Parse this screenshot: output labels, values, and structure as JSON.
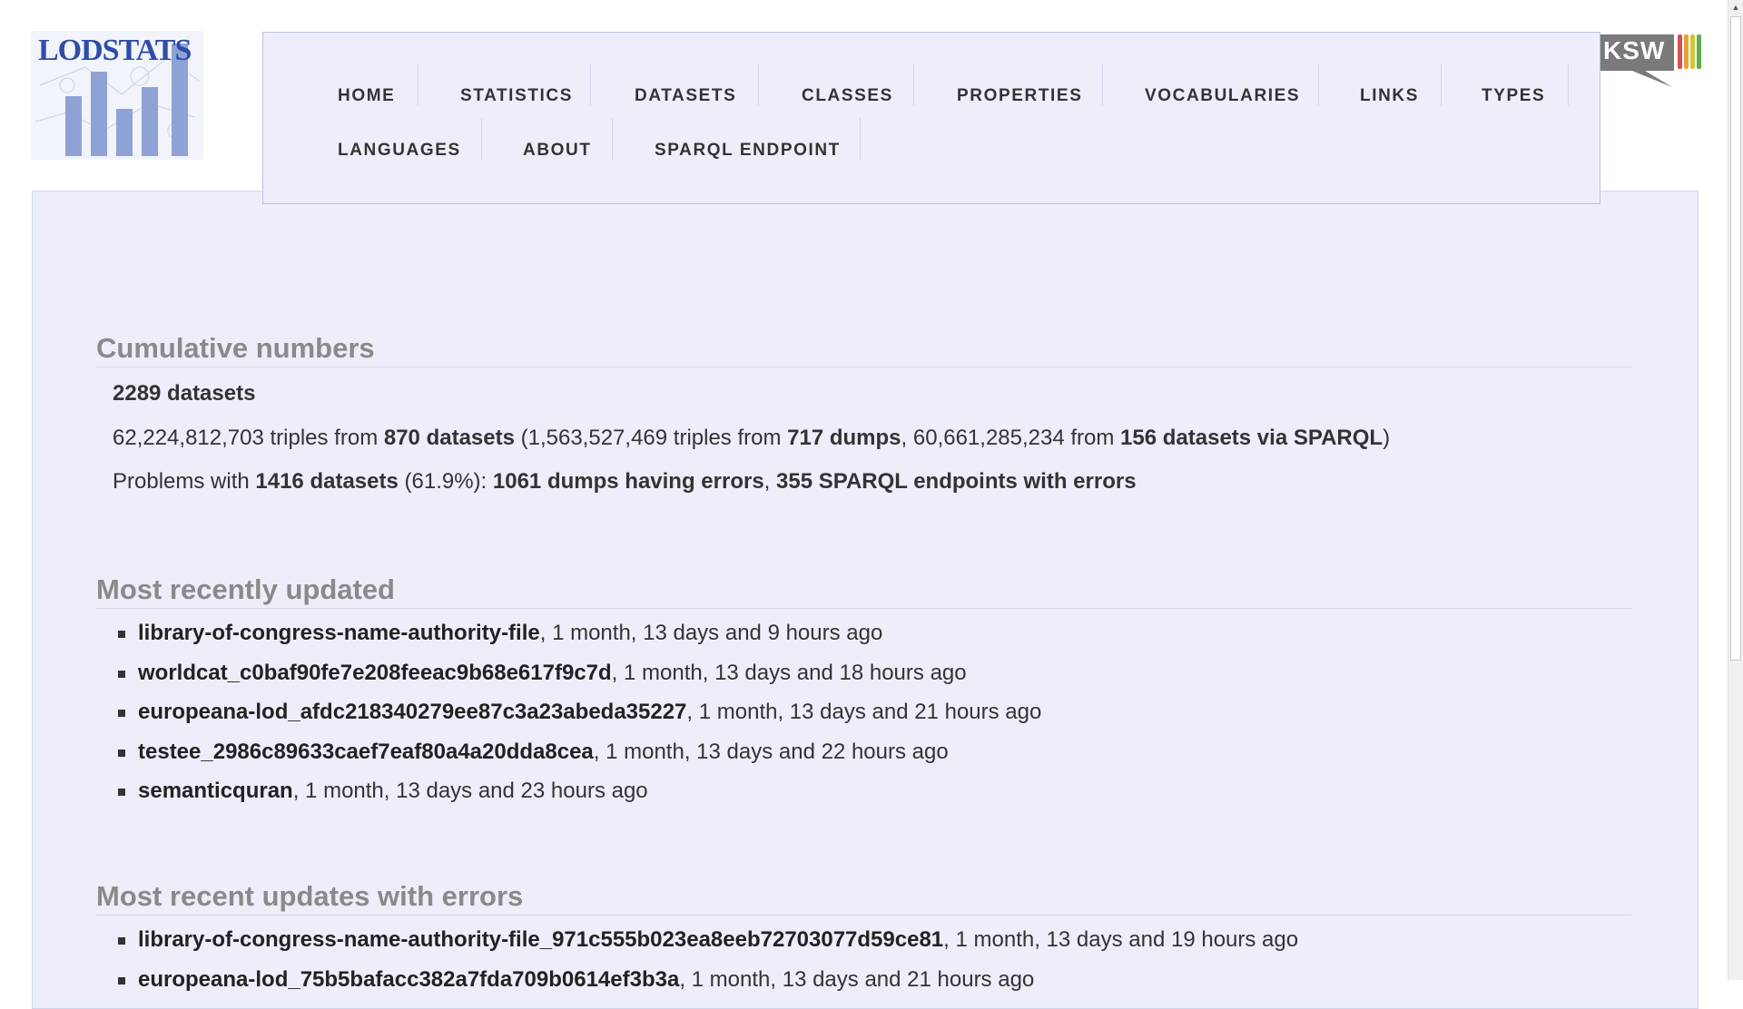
{
  "logo": {
    "text": "LODSTATS",
    "aksw_text": "KSW"
  },
  "nav": {
    "items": [
      "HOME",
      "STATISTICS",
      "DATASETS",
      "CLASSES",
      "PROPERTIES",
      "VOCABULARIES",
      "LINKS",
      "TYPES",
      "LANGUAGES",
      "ABOUT",
      "SPARQL ENDPOINT"
    ]
  },
  "cumulative": {
    "heading": "Cumulative numbers",
    "datasets_total": "2289 datasets",
    "triples_total": "62,224,812,703",
    "triples_from": " triples from ",
    "datasets_count": "870 datasets",
    "paren_open": " (",
    "dump_triples": "1,563,527,469",
    "dump_from": " triples from ",
    "dumps": "717 dumps",
    "comma": ", ",
    "sparql_triples": "60,661,285,234",
    "sparql_from": " from ",
    "sparql_datasets": "156 datasets via SPARQL",
    "paren_close": ")",
    "problems_prefix": "Problems with ",
    "problems_datasets": "1416 datasets",
    "problems_pct": " (61.9%): ",
    "dumps_errors": "1061 dumps having errors",
    "sep": ", ",
    "sparql_errors": "355 SPARQL endpoints with errors"
  },
  "recent": {
    "heading": "Most recently updated",
    "items": [
      {
        "name": "library-of-congress-name-authority-file",
        "time": ", 1 month, 13 days and 9 hours ago"
      },
      {
        "name": "worldcat_c0baf90fe7e208feeac9b68e617f9c7d",
        "time": ", 1 month, 13 days and 18 hours ago"
      },
      {
        "name": "europeana-lod_afdc218340279ee87c3a23abeda35227",
        "time": ", 1 month, 13 days and 21 hours ago"
      },
      {
        "name": "testee_2986c89633caef7eaf80a4a20dda8cea",
        "time": ", 1 month, 13 days and 22 hours ago"
      },
      {
        "name": "semanticquran",
        "time": ", 1 month, 13 days and 23 hours ago"
      }
    ]
  },
  "errors": {
    "heading": "Most recent updates with errors",
    "items": [
      {
        "name": "library-of-congress-name-authority-file_971c555b023ea8eeb72703077d59ce81",
        "time": ", 1 month, 13 days and 19 hours ago"
      },
      {
        "name": "europeana-lod_75b5bafacc382a7fda709b0614ef3b3a",
        "time": ", 1 month, 13 days and 21 hours ago"
      }
    ]
  }
}
